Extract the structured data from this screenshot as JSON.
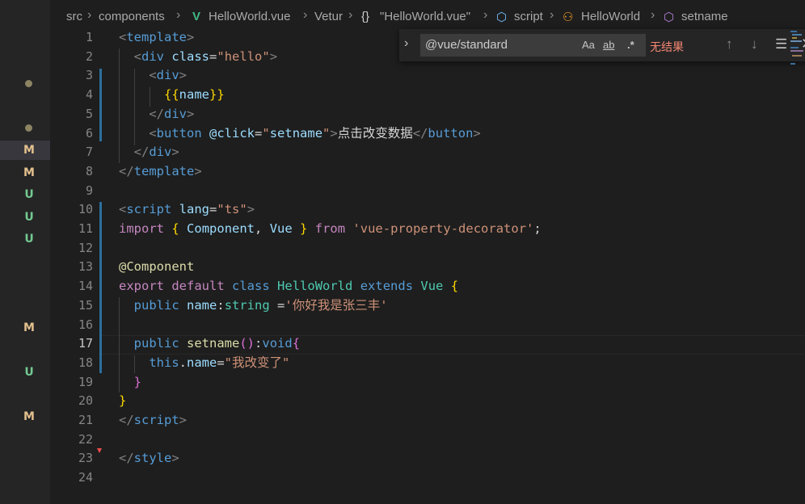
{
  "breadcrumb": {
    "src": "src",
    "components": "components",
    "file": "HelloWorld.vue",
    "vetur": "Vetur",
    "module": "\"HelloWorld.vue\"",
    "script": "script",
    "class": "HelloWorld",
    "method": "setname"
  },
  "find": {
    "query": "@vue/standard",
    "match_case": "Aa",
    "whole_word": "ab",
    "regex": ".*",
    "result": "无结果"
  },
  "sidebar": {
    "badges": [
      "M",
      "M",
      "U",
      "U",
      "U",
      "M",
      "U",
      "M"
    ]
  },
  "colors": {
    "modified": "#e2c08d",
    "untracked": "#73c991",
    "accent": "#007acc",
    "error": "#f48771"
  },
  "code": {
    "current_line": 17,
    "lines": [
      [
        [
          "t-tag",
          "<"
        ],
        [
          "t-name",
          "template"
        ],
        [
          "t-tag",
          ">"
        ]
      ],
      [
        [
          "t-text",
          "  "
        ],
        [
          "t-tag",
          "<"
        ],
        [
          "t-name",
          "div"
        ],
        [
          "t-text",
          " "
        ],
        [
          "t-attr",
          "class"
        ],
        [
          "t-text",
          "="
        ],
        [
          "t-str",
          "\"hello\""
        ],
        [
          "t-tag",
          ">"
        ]
      ],
      [
        [
          "t-text",
          "    "
        ],
        [
          "t-tag",
          "<"
        ],
        [
          "t-name",
          "div"
        ],
        [
          "t-tag",
          ">"
        ]
      ],
      [
        [
          "t-text",
          "      "
        ],
        [
          "t-br1",
          "{{"
        ],
        [
          "t-attr",
          "name"
        ],
        [
          "t-br1",
          "}}"
        ]
      ],
      [
        [
          "t-text",
          "    "
        ],
        [
          "t-tag",
          "</"
        ],
        [
          "t-name",
          "div"
        ],
        [
          "t-tag",
          ">"
        ]
      ],
      [
        [
          "t-text",
          "    "
        ],
        [
          "t-tag",
          "<"
        ],
        [
          "t-name",
          "button"
        ],
        [
          "t-text",
          " "
        ],
        [
          "t-attr",
          "@click"
        ],
        [
          "t-text",
          "="
        ],
        [
          "t-str",
          "\""
        ],
        [
          "t-attr",
          "setname"
        ],
        [
          "t-str",
          "\""
        ],
        [
          "t-tag",
          ">"
        ],
        [
          "t-text",
          "点击改变数据"
        ],
        [
          "t-tag",
          "</"
        ],
        [
          "t-name",
          "button"
        ],
        [
          "t-tag",
          ">"
        ]
      ],
      [
        [
          "t-text",
          "  "
        ],
        [
          "t-tag",
          "</"
        ],
        [
          "t-name",
          "div"
        ],
        [
          "t-tag",
          ">"
        ]
      ],
      [
        [
          "t-tag",
          "</"
        ],
        [
          "t-name",
          "template"
        ],
        [
          "t-tag",
          ">"
        ]
      ],
      [],
      [
        [
          "t-tag",
          "<"
        ],
        [
          "t-name",
          "script"
        ],
        [
          "t-text",
          " "
        ],
        [
          "t-attr",
          "lang"
        ],
        [
          "t-text",
          "="
        ],
        [
          "t-str",
          "\"ts\""
        ],
        [
          "t-tag",
          ">"
        ]
      ],
      [
        [
          "t-kw",
          "import"
        ],
        [
          "t-text",
          " "
        ],
        [
          "t-br1",
          "{"
        ],
        [
          "t-text",
          " "
        ],
        [
          "t-attr",
          "Component"
        ],
        [
          "t-text",
          ", "
        ],
        [
          "t-attr",
          "Vue"
        ],
        [
          "t-text",
          " "
        ],
        [
          "t-br1",
          "}"
        ],
        [
          "t-text",
          " "
        ],
        [
          "t-kw",
          "from"
        ],
        [
          "t-text",
          " "
        ],
        [
          "t-str",
          "'vue-property-decorator'"
        ],
        [
          "t-text",
          ";"
        ]
      ],
      [],
      [
        [
          "t-fn",
          "@Component"
        ]
      ],
      [
        [
          "t-kw",
          "export"
        ],
        [
          "t-text",
          " "
        ],
        [
          "t-kw",
          "default"
        ],
        [
          "t-text",
          " "
        ],
        [
          "t-kw2",
          "class"
        ],
        [
          "t-text",
          " "
        ],
        [
          "t-type",
          "HelloWorld"
        ],
        [
          "t-text",
          " "
        ],
        [
          "t-kw2",
          "extends"
        ],
        [
          "t-text",
          " "
        ],
        [
          "t-type",
          "Vue"
        ],
        [
          "t-text",
          " "
        ],
        [
          "t-br1",
          "{"
        ]
      ],
      [
        [
          "t-text",
          "  "
        ],
        [
          "t-kw2",
          "public"
        ],
        [
          "t-text",
          " "
        ],
        [
          "t-attr",
          "name"
        ],
        [
          "t-text",
          ":"
        ],
        [
          "t-type",
          "string"
        ],
        [
          "t-text",
          " ="
        ],
        [
          "t-str",
          "'你好我是张三丰'"
        ]
      ],
      [],
      [
        [
          "t-text",
          "  "
        ],
        [
          "t-kw2",
          "public"
        ],
        [
          "t-text",
          " "
        ],
        [
          "t-fn",
          "setname"
        ],
        [
          "t-br2",
          "()"
        ],
        [
          "t-text",
          ":"
        ],
        [
          "t-kw2",
          "void"
        ],
        [
          "t-br2",
          "{"
        ]
      ],
      [
        [
          "t-text",
          "    "
        ],
        [
          "t-kw2",
          "this"
        ],
        [
          "t-text",
          "."
        ],
        [
          "t-attr",
          "name"
        ],
        [
          "t-text",
          "="
        ],
        [
          "t-str",
          "\"我改变了\""
        ]
      ],
      [
        [
          "t-text",
          "  "
        ],
        [
          "t-br2",
          "}"
        ]
      ],
      [
        [
          "t-br1",
          "}"
        ]
      ],
      [
        [
          "t-tag",
          "</"
        ],
        [
          "t-name",
          "script"
        ],
        [
          "t-tag",
          ">"
        ]
      ],
      [],
      [
        [
          "t-tag",
          "</"
        ],
        [
          "t-name",
          "style"
        ],
        [
          "t-tag",
          ">"
        ]
      ],
      []
    ]
  }
}
